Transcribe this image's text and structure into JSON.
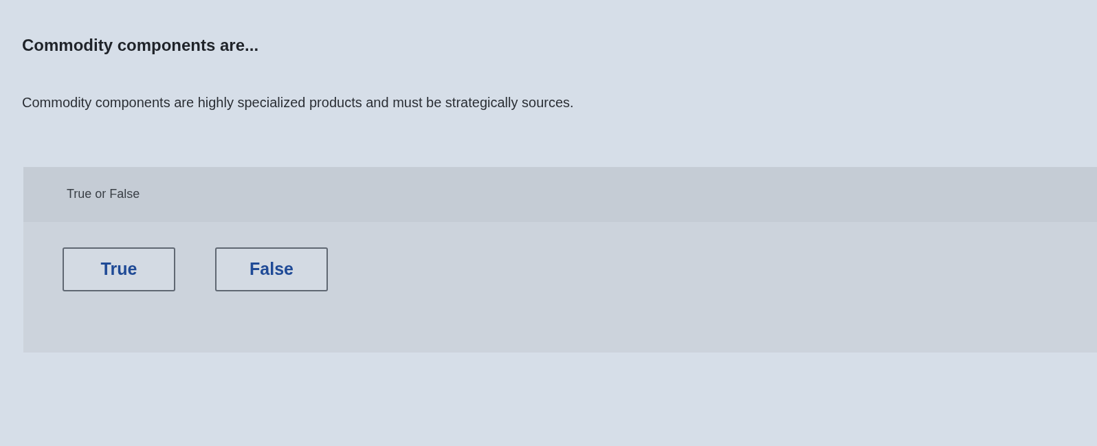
{
  "question": {
    "title": "Commodity components are...",
    "prompt": "Commodity components are highly specialized products and must be strategically sources."
  },
  "answer_panel": {
    "header": "True or False",
    "options": [
      {
        "label": "True"
      },
      {
        "label": "False"
      }
    ]
  }
}
